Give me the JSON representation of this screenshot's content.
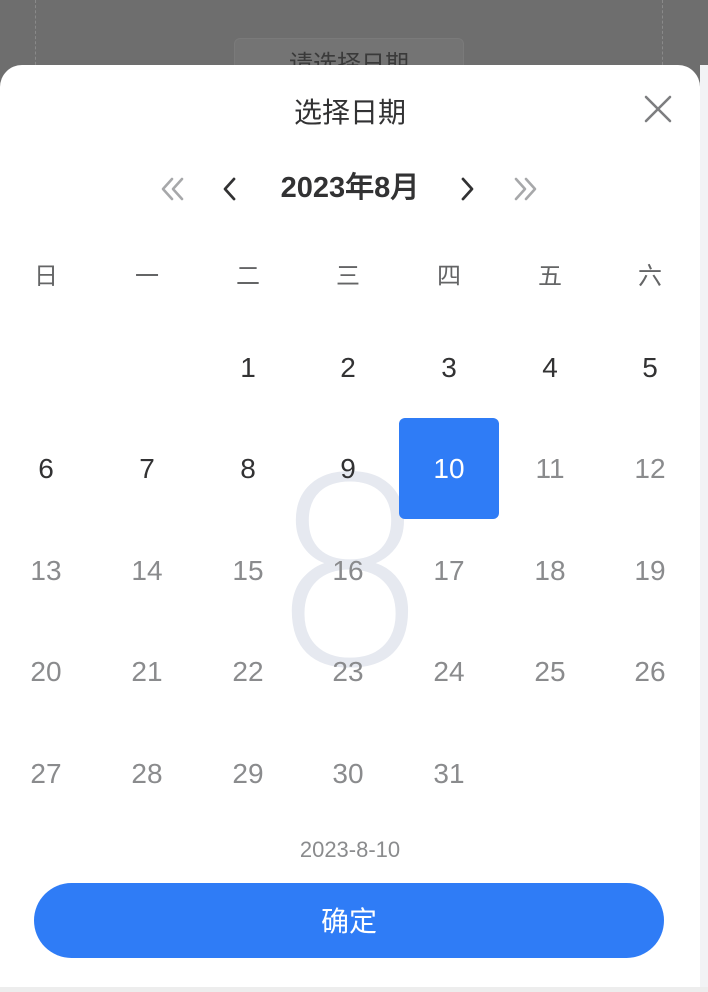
{
  "background": {
    "button_label": "请选择日期"
  },
  "picker": {
    "title": "选择日期",
    "month_label": "2023年8月",
    "prev_year": "«",
    "prev_month": "‹",
    "next_month": "›",
    "next_year": "»",
    "watermark": "8",
    "weekdays": [
      "日",
      "一",
      "二",
      "三",
      "四",
      "五",
      "六"
    ],
    "days": {
      "d1": "1",
      "d2": "2",
      "d3": "3",
      "d4": "4",
      "d5": "5",
      "d6": "6",
      "d7": "7",
      "d8": "8",
      "d9": "9",
      "d10": "10",
      "d11": "11",
      "d12": "12",
      "d13": "13",
      "d14": "14",
      "d15": "15",
      "d16": "16",
      "d17": "17",
      "d18": "18",
      "d19": "19",
      "d20": "20",
      "d21": "21",
      "d22": "22",
      "d23": "23",
      "d24": "24",
      "d25": "25",
      "d26": "26",
      "d27": "27",
      "d28": "28",
      "d29": "29",
      "d30": "30",
      "d31": "31"
    },
    "selected_day": "10",
    "selected_date_text": "2023-8-10",
    "confirm_label": "确定"
  },
  "colors": {
    "accent": "#2f7cf6",
    "enabled_day": "#323233",
    "disabled_day": "#8a8b8d",
    "watermark": "#e6e9f0"
  }
}
